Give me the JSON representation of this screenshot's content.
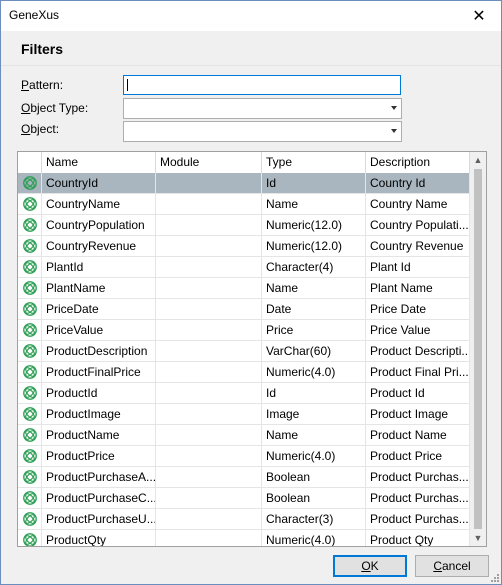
{
  "window": {
    "title": "GeneXus",
    "close_glyph": "✕"
  },
  "filters": {
    "heading": "Filters",
    "pattern": {
      "accel": "P",
      "rest": "attern:",
      "value": ""
    },
    "object_type": {
      "accel": "O",
      "rest": "bject Type:",
      "value": ""
    },
    "object": {
      "accel": "O",
      "rest": "bject:",
      "value": ""
    }
  },
  "grid": {
    "columns": [
      "Name",
      "Module",
      "Type",
      "Description"
    ],
    "rows": [
      {
        "name": "CountryId",
        "module": "",
        "type": "Id",
        "description": "Country Id",
        "selected": true
      },
      {
        "name": "CountryName",
        "module": "",
        "type": "Name",
        "description": "Country Name"
      },
      {
        "name": "CountryPopulation",
        "module": "",
        "type": "Numeric(12.0)",
        "description": "Country Populati..."
      },
      {
        "name": "CountryRevenue",
        "module": "",
        "type": "Numeric(12.0)",
        "description": "Country Revenue"
      },
      {
        "name": "PlantId",
        "module": "",
        "type": "Character(4)",
        "description": "Plant Id"
      },
      {
        "name": "PlantName",
        "module": "",
        "type": "Name",
        "description": "Plant Name"
      },
      {
        "name": "PriceDate",
        "module": "",
        "type": "Date",
        "description": "Price Date"
      },
      {
        "name": "PriceValue",
        "module": "",
        "type": "Price",
        "description": "Price Value"
      },
      {
        "name": "ProductDescription",
        "module": "",
        "type": "VarChar(60)",
        "description": "Product Descripti..."
      },
      {
        "name": "ProductFinalPrice",
        "module": "",
        "type": "Numeric(4.0)",
        "description": "Product Final Pri..."
      },
      {
        "name": "ProductId",
        "module": "",
        "type": "Id",
        "description": "Product Id"
      },
      {
        "name": "ProductImage",
        "module": "",
        "type": "Image",
        "description": "Product Image"
      },
      {
        "name": "ProductName",
        "module": "",
        "type": "Name",
        "description": "Product Name"
      },
      {
        "name": "ProductPrice",
        "module": "",
        "type": "Numeric(4.0)",
        "description": "Product Price"
      },
      {
        "name": "ProductPurchaseA...",
        "module": "",
        "type": "Boolean",
        "description": "Product Purchas..."
      },
      {
        "name": "ProductPurchaseC...",
        "module": "",
        "type": "Boolean",
        "description": "Product Purchas..."
      },
      {
        "name": "ProductPurchaseU...",
        "module": "",
        "type": "Character(3)",
        "description": "Product Purchas..."
      },
      {
        "name": "ProductQty",
        "module": "",
        "type": "Numeric(4.0)",
        "description": "Product Qty"
      }
    ]
  },
  "buttons": {
    "ok": {
      "accel": "O",
      "rest": "K"
    },
    "cancel": {
      "accel": "C",
      "rest": "ancel"
    }
  },
  "icons": {
    "row_icon": "attribute-icon",
    "scroll_up": "▲",
    "scroll_down": "▼"
  },
  "colors": {
    "selection": "#a9b6bf",
    "icon_green": "#2e9e55",
    "focus_blue": "#0078d7"
  }
}
